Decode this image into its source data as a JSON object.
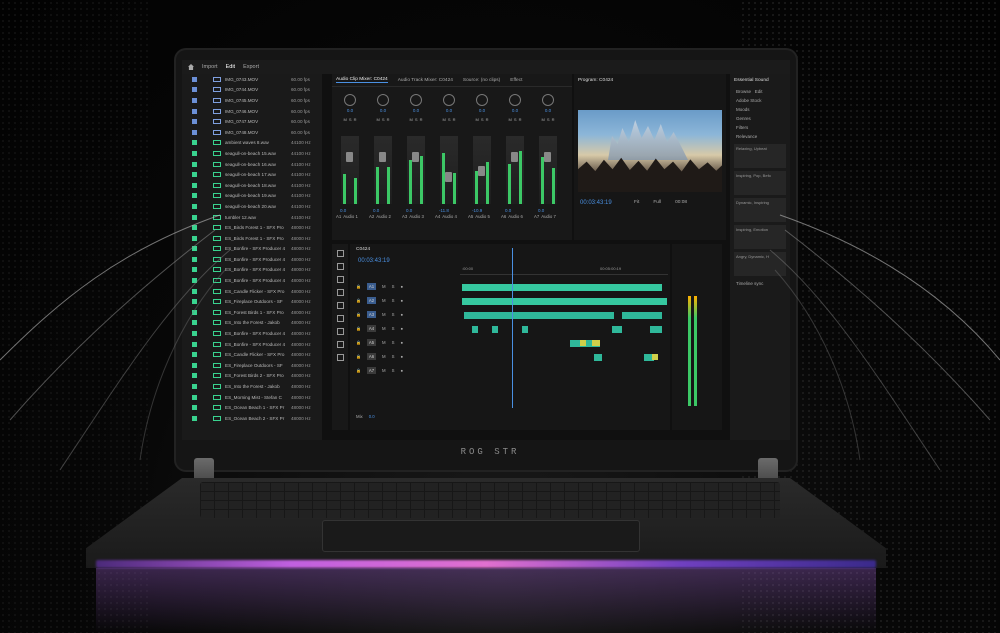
{
  "topbar": {
    "import": "Import",
    "edit": "Edit",
    "export": "Export"
  },
  "project_items": [
    {
      "name": "IMG_0743.MOV",
      "rate": "60.00 fps",
      "type": "video"
    },
    {
      "name": "IMG_0744.MOV",
      "rate": "60.00 fps",
      "type": "video"
    },
    {
      "name": "IMG_0745.MOV",
      "rate": "60.00 fps",
      "type": "video"
    },
    {
      "name": "IMG_0746.MOV",
      "rate": "60.00 fps",
      "type": "video"
    },
    {
      "name": "IMG_0747.MOV",
      "rate": "60.00 fps",
      "type": "video"
    },
    {
      "name": "IMG_0748.MOV",
      "rate": "60.00 fps",
      "type": "video"
    },
    {
      "name": "ambient waves 8.wav",
      "rate": "44100 Hz",
      "type": "audio"
    },
    {
      "name": "seagull-on-beach 15.wav",
      "rate": "44100 Hz",
      "type": "audio"
    },
    {
      "name": "seagull-on-beach 16.wav",
      "rate": "44100 Hz",
      "type": "audio"
    },
    {
      "name": "seagull-on-beach 17.wav",
      "rate": "44100 Hz",
      "type": "audio"
    },
    {
      "name": "seagull-on-beach 18.wav",
      "rate": "44100 Hz",
      "type": "audio"
    },
    {
      "name": "seagull-on-beach 19.wav",
      "rate": "44100 Hz",
      "type": "audio"
    },
    {
      "name": "seagull-on-beach 20.wav",
      "rate": "44100 Hz",
      "type": "audio"
    },
    {
      "name": "tumbler 12.wav",
      "rate": "44100 Hz",
      "type": "audio"
    },
    {
      "name": "ES_Birds Forest 1 - SFX Pro",
      "rate": "48000 Hz",
      "type": "audio"
    },
    {
      "name": "ES_Birds Forest 1 - SFX Pro",
      "rate": "48000 Hz",
      "type": "audio"
    },
    {
      "name": "ES_Bonfire - SFX Producer 4",
      "rate": "48000 Hz",
      "type": "audio"
    },
    {
      "name": "ES_Bonfire - SFX Producer 4",
      "rate": "48000 Hz",
      "type": "audio"
    },
    {
      "name": "ES_Bonfire - SFX Producer 4",
      "rate": "48000 Hz",
      "type": "audio"
    },
    {
      "name": "ES_Bonfire - SFX Producer 4",
      "rate": "48000 Hz",
      "type": "audio"
    },
    {
      "name": "ES_Candle Flicker - SFX Pro",
      "rate": "48000 Hz",
      "type": "audio"
    },
    {
      "name": "ES_Fireplace Outdoors - SF",
      "rate": "48000 Hz",
      "type": "audio"
    },
    {
      "name": "ES_Forest Birds 1 - SFX Pro",
      "rate": "48000 Hz",
      "type": "audio"
    },
    {
      "name": "ES_Into the Forest - Jakob",
      "rate": "48000 Hz",
      "type": "audio"
    },
    {
      "name": "ES_Bonfire - SFX Producer 4",
      "rate": "48000 Hz",
      "type": "audio"
    },
    {
      "name": "ES_Bonfire - SFX Producer 4",
      "rate": "48000 Hz",
      "type": "audio"
    },
    {
      "name": "ES_Candle Flicker - SFX Pro",
      "rate": "48000 Hz",
      "type": "audio"
    },
    {
      "name": "ES_Fireplace Outdoors - SF",
      "rate": "48000 Hz",
      "type": "audio"
    },
    {
      "name": "ES_Forest Birds 2 - SFX Pro",
      "rate": "48000 Hz",
      "type": "audio"
    },
    {
      "name": "ES_Into the Forest - Jakob",
      "rate": "48000 Hz",
      "type": "audio"
    },
    {
      "name": "ES_Morning Mist - Stefan C",
      "rate": "48000 Hz",
      "type": "audio"
    },
    {
      "name": "ES_Ocean Beach 1 - SFX Pr",
      "rate": "48000 Hz",
      "type": "audio"
    },
    {
      "name": "ES_Ocean Beach 2 - SFX Pr",
      "rate": "48000 Hz",
      "type": "audio"
    }
  ],
  "mixer": {
    "tabs": [
      "Audio Clip Mixer: C0424",
      "Audio Track Mixer: C0424",
      "Source: (no clips)",
      "Effect"
    ],
    "channels": [
      {
        "pan": "0.0",
        "name": "Audio 1",
        "id": "A1",
        "gain": "0.0"
      },
      {
        "pan": "0.0",
        "name": "Audio 2",
        "id": "A2",
        "gain": "0.0"
      },
      {
        "pan": "0.0",
        "name": "Audio 3",
        "id": "A3",
        "gain": "0.0"
      },
      {
        "pan": "0.0",
        "name": "Audio 4",
        "id": "A4",
        "gain": "-11.8"
      },
      {
        "pan": "0.0",
        "name": "Audio 5",
        "id": "A5",
        "gain": "-10.9"
      },
      {
        "pan": "0.0",
        "name": "Audio 6",
        "id": "A6",
        "gain": "0.0"
      },
      {
        "pan": "0.0",
        "name": "Audio 7",
        "id": "A7",
        "gain": "0.0"
      }
    ]
  },
  "program": {
    "title": "Program: C0424",
    "timecode": "00:03:43:19",
    "fit": "Fit",
    "full": "Full",
    "end_tc": "00:08"
  },
  "essential": {
    "title": "Essential Sound",
    "tab_browse": "Browse",
    "tab_edit": "Edit",
    "adobe_stock": "Adobe Stock",
    "moods": "Moods",
    "genres": "Genres",
    "filters": "Filters",
    "relevance": "Relevance",
    "timeline_sync": "Timeline sync",
    "results": [
      "Relaxing, Upbeat",
      "Inspiring, Pop, Befo",
      "Dynamic, Inspiring",
      "Inspiring, Emotion",
      "Angry, Dynamic, H"
    ]
  },
  "timeline": {
    "title": "C0424",
    "timecode": "00:03:43:19",
    "ruler_start": ":00:00",
    "ruler_mid": "00:05:00:19",
    "tracks": [
      {
        "id": "A1"
      },
      {
        "id": "A2"
      },
      {
        "id": "A3"
      },
      {
        "id": "A4"
      },
      {
        "id": "A5"
      },
      {
        "id": "A6"
      },
      {
        "id": "A7"
      }
    ],
    "mix_label": "Mix",
    "mix_value": "0.0"
  },
  "laptop": {
    "brand": "ROG STR"
  },
  "colors": {
    "accent": "#4a90e2",
    "label_green": "#39d38f",
    "clip_teal": "#2fb89a",
    "clip_yellow": "#cfd04a"
  }
}
